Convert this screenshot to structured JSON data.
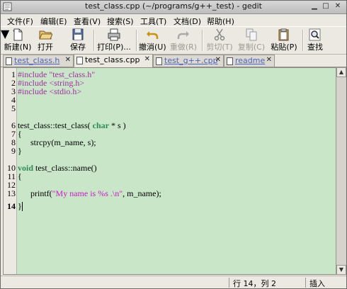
{
  "window": {
    "title": "test_class.cpp (~/programs/g++_test) - gedit"
  },
  "menu": [
    "文件(F)",
    "编辑(E)",
    "查看(V)",
    "搜索(S)",
    "工具(T)",
    "文档(D)",
    "帮助(H)"
  ],
  "toolbar": {
    "new": "新建(N)",
    "open": "打开",
    "save": "保存",
    "print": "打印(P)...",
    "undo": "撤消(U)",
    "redo": "重做(R)",
    "cut": "剪切(T)",
    "copy": "复制(C)",
    "paste": "粘贴(P)",
    "find": "查找"
  },
  "tabs": [
    {
      "label": "test_class.h",
      "active": false
    },
    {
      "label": "test_class.cpp",
      "active": true
    },
    {
      "label": "test_g++.cpp",
      "active": false
    },
    {
      "label": "readme",
      "active": false
    }
  ],
  "editor": {
    "line_numbers": [
      "1",
      "2",
      "3",
      "4",
      "5",
      "6",
      "7",
      "8",
      "9",
      "10",
      "11",
      "12",
      "13",
      "14"
    ],
    "current_line": 14,
    "code": {
      "l1": "#include \"test_class.h\"",
      "l2": "#include <string.h>",
      "l3": "#include <stdio.h>",
      "l6a": "test_class::test_class( ",
      "l6kw": "char",
      "l6b": " * s )",
      "l7": "{",
      "l8": "      strcpy(m_name, s);",
      "l9": "}",
      "l11kw": "void",
      "l11b": " test_class::name()",
      "l12": "{",
      "l13a": "      printf(",
      "l13str": "\"My name is %s .\\n\"",
      "l13b": ", m_name);",
      "l14": "}"
    }
  },
  "status": {
    "position": "行 14，列 2",
    "mode": "插入"
  },
  "icons": {
    "new": "new-document-icon",
    "open": "open-folder-icon",
    "save": "save-floppy-icon",
    "print": "printer-icon",
    "undo": "undo-arrow-icon",
    "redo": "redo-arrow-icon",
    "cut": "scissors-icon",
    "copy": "copy-icon",
    "paste": "clipboard-icon",
    "find": "magnifier-icon"
  },
  "colors": {
    "editor_bg": "#c9e6c9",
    "preprocessor": "#9f2f9f",
    "keyword": "#2e8b57",
    "string": "#c81ac8"
  }
}
